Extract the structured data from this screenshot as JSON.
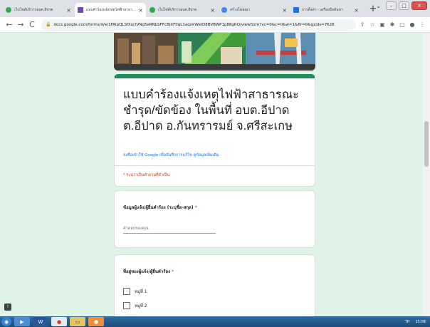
{
  "tabs": [
    {
      "label": "เว็บไซต์บริการอบต.อีปาด"
    },
    {
      "label": "แบบคำร้องแจ้งเหตุไฟฟ้าสาธารณะ"
    },
    {
      "label": "เว็บไซต์บริการอบต.อีปาด"
    },
    {
      "label": "สร้างโฆษณา"
    },
    {
      "label": "การตั้งค่า - เครื่องมือค้นหา"
    }
  ],
  "address_bar": {
    "url": "docs.google.com/forms/d/e/1FAIpQLSfXurtVNg5eRNbbFFcBjitF0qL1aqnkWetD8BVBWP1p88gRQ/viewform?vc=0&c=0&w=1&flr=0&gxids=7628"
  },
  "form": {
    "title": "แบบคำร้องแจ้งเหตุไฟฟ้าสาธารณะชำรุด/ขัดข้อง ในพื้นที่ อบต.อีปาด ต.อีปาด อ.กันทรารมย์ จ.ศรีสะเกษ",
    "signin_note": "ลงชื่อเข้าใช้ Google เพื่อบันทึกการแก้ไข ดูข้อมูลเพิ่มเติม",
    "required_note": "* ระบุว่าเป็นคำถามที่จำเป็น",
    "q1": {
      "label": "ข้อมูลผู้แจ้ง/ผู้ยื่นคำร้อง (ระบุชื่อ-สกุล)",
      "required_mark": "*",
      "placeholder": "คำตอบของคุณ"
    },
    "q2": {
      "label": "ที่อยู่ของผู้แจ้ง/ผู้ยื่นคำร้อง",
      "required_mark": "*",
      "options": [
        "หมู่ที่ 1",
        "หมู่ที่ 2"
      ]
    }
  },
  "taskbar": {
    "lang": "TH",
    "time": "15:08"
  },
  "colors": {
    "accent": "#1e8e5a",
    "page_bg": "#dff3e6",
    "required": "#d93025"
  }
}
